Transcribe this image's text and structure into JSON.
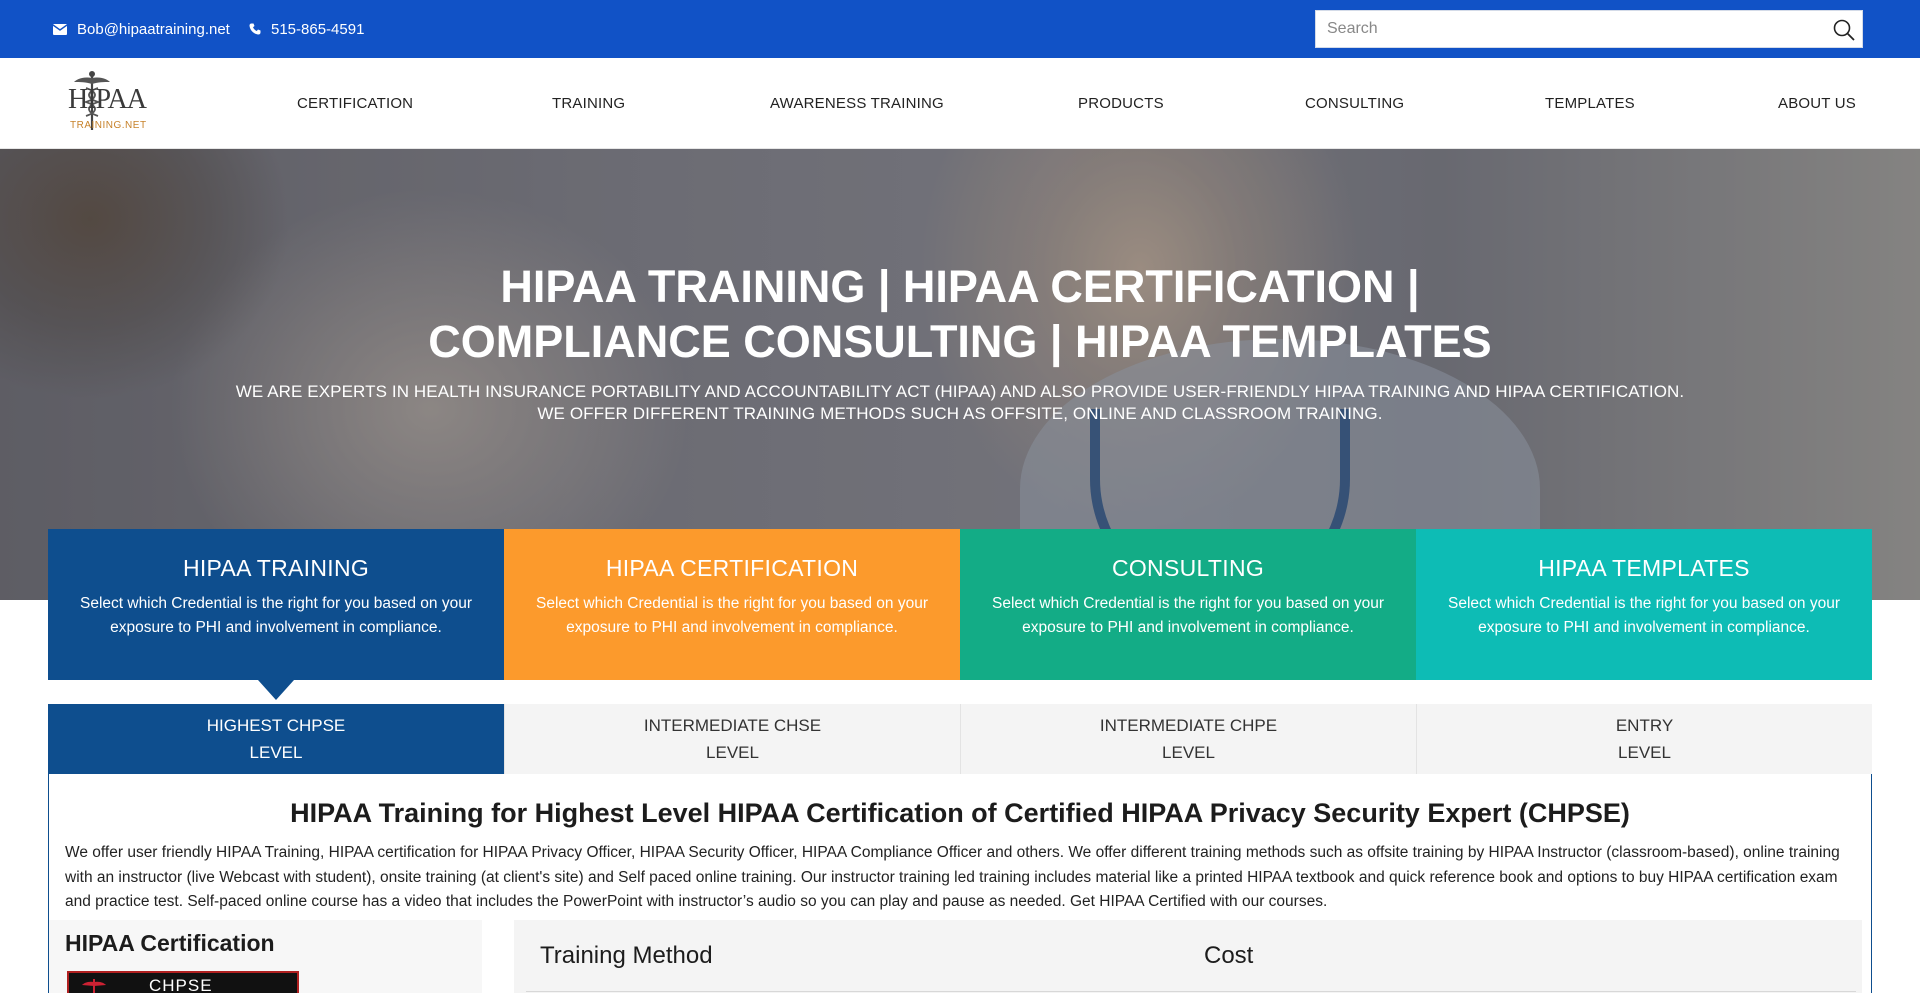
{
  "topbar": {
    "email": "Bob@hipaatraining.net",
    "phone": "515-865-4591",
    "search_placeholder": "Search"
  },
  "logo": {
    "main": "HIPAA",
    "sub": "TRAINING.NET"
  },
  "nav": [
    {
      "label": "CERTIFICATION"
    },
    {
      "label": "TRAINING"
    },
    {
      "label": "AWARENESS TRAINING"
    },
    {
      "label": "PRODUCTS"
    },
    {
      "label": "CONSULTING"
    },
    {
      "label": "TEMPLATES"
    },
    {
      "label": "ABOUT US"
    }
  ],
  "hero": {
    "title_line1": "HIPAA TRAINING | HIPAA CERTIFICATION |",
    "title_line2": "COMPLIANCE CONSULTING | HIPAA TEMPLATES",
    "sub_line1": "WE ARE EXPERTS IN HEALTH INSURANCE PORTABILITY AND ACCOUNTABILITY ACT (HIPAA) AND ALSO PROVIDE USER-FRIENDLY HIPAA TRAINING AND HIPAA CERTIFICATION.",
    "sub_line2": "WE OFFER DIFFERENT TRAINING METHODS SUCH AS OFFSITE, ONLINE AND CLASSROOM TRAINING."
  },
  "cards": [
    {
      "title": "HIPAA TRAINING",
      "desc": "Select which Credential is the right for you based on your exposure to PHI and involvement in compliance."
    },
    {
      "title": "HIPAA CERTIFICATION",
      "desc": "Select which Credential is the right for you based on your exposure to PHI and involvement in compliance."
    },
    {
      "title": "CONSULTING",
      "desc": "Select which Credential is the right for you based on your exposure to PHI and involvement in compliance."
    },
    {
      "title": "HIPAA TEMPLATES",
      "desc": "Select which Credential is the right for you based on your exposure to PHI and involvement in compliance."
    }
  ],
  "tabs": [
    {
      "line1": "HIGHEST CHPSE",
      "line2": "LEVEL"
    },
    {
      "line1": "INTERMEDIATE CHSE",
      "line2": "LEVEL"
    },
    {
      "line1": "INTERMEDIATE CHPE",
      "line2": "LEVEL"
    },
    {
      "line1": "ENTRY",
      "line2": "LEVEL"
    }
  ],
  "panel": {
    "title": "HIPAA Training for Highest Level HIPAA Certification of Certified HIPAA Privacy Security Expert (CHPSE)",
    "text": "We offer user friendly HIPAA Training, HIPAA certification for HIPAA Privacy Officer, HIPAA Security Officer, HIPAA Compliance Officer and others. We offer different training methods such as offsite training by HIPAA Instructor (classroom-based), online training with an instructor (live Webcast with student), onsite training (at client's site) and Self paced online training. Our instructor training led training includes material like a printed HIPAA textbook and quick reference book and options to buy HIPAA certification exam and practice test. Self-paced online course has a video that includes the PowerPoint with instructor’s audio so you can play and pause as needed. Get HIPAA Certified with our courses.",
    "side_title": "HIPAA Certification",
    "badge_text": "CHPSE",
    "method_header": "Training Method",
    "cost_header": "Cost"
  },
  "colors": {
    "topbar": "#1152c6",
    "card_training": "#0e4e8e",
    "card_certification": "#fc9a2c",
    "card_consulting": "#13ac86",
    "card_templates": "#0dbcb5"
  },
  "icons": {
    "email": "envelope-icon",
    "phone": "phone-icon",
    "search": "search-icon",
    "logo": "caduceus-icon"
  }
}
